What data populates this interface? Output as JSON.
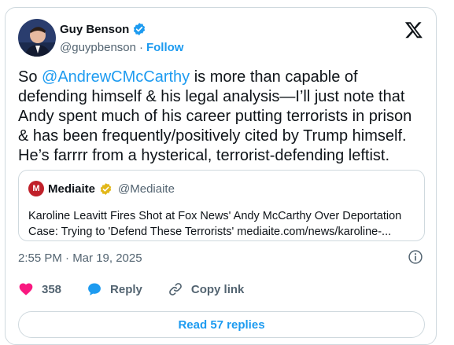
{
  "author": {
    "name": "Guy Benson",
    "handle": "@guypbenson",
    "separator": "·",
    "follow_label": "Follow"
  },
  "tweet": {
    "lines": [
      {
        "pre": "So ",
        "mention": "@AndrewCMcCarthy",
        "post": " is more than capable of"
      },
      {
        "text": "defending himself & his legal analysis—I’ll just note that"
      },
      {
        "text": "Andy spent much of his career putting terrorists in prison"
      },
      {
        "text": "& has been frequently/positively cited by Trump himself."
      },
      {
        "text": "He’s farrrr from a hysterical, terrorist-defending leftist."
      }
    ]
  },
  "quote": {
    "avatar_letter": "M",
    "name": "Mediaite",
    "handle": "@Mediaite",
    "lines": [
      "Karoline Leavitt Fires Shot at Fox News' Andy McCarthy Over Deportation",
      "Case: Trying to 'Defend These Terrorists'  mediaite.com/news/karoline-..."
    ]
  },
  "timestamp": "2:55 PM · Mar 19, 2025",
  "actions": {
    "like_count": "358",
    "reply_label": "Reply",
    "copy_link_label": "Copy link"
  },
  "read_replies_label": "Read 57 replies",
  "icons": {
    "verified": "verified-badge-icon",
    "gold_verified": "gold-verified-badge-icon",
    "x_logo": "x-logo-icon",
    "info": "info-icon",
    "heart": "heart-icon",
    "reply": "reply-bubble-icon",
    "link": "link-icon"
  },
  "colors": {
    "accent": "#1d9bf0",
    "heart": "#f91880",
    "muted": "#536471",
    "border": "#cfd9de",
    "gold": "#e2b719",
    "mediaite_red": "#c0202a"
  }
}
